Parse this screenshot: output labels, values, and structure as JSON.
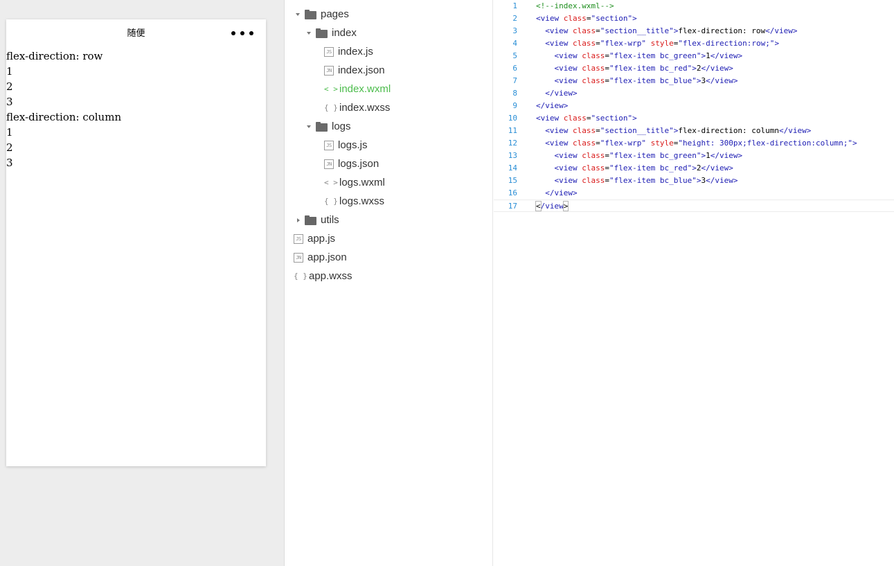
{
  "simulator": {
    "nav_title": "随便",
    "menu_icon": "more-dots-icon",
    "lines": [
      "flex-direction: row",
      "1",
      "2",
      "3",
      "flex-direction: column",
      "1",
      "2",
      "3"
    ]
  },
  "file_tree": {
    "items": [
      {
        "label": "pages",
        "type": "folder",
        "expanded": true,
        "depth": 0,
        "icon": "folder-open-icon"
      },
      {
        "label": "index",
        "type": "folder",
        "expanded": true,
        "depth": 1,
        "icon": "folder-open-icon"
      },
      {
        "label": "index.js",
        "type": "file",
        "badge": "JS",
        "depth": 2,
        "icon": "js-file-icon"
      },
      {
        "label": "index.json",
        "type": "file",
        "badge": "JN",
        "depth": 2,
        "icon": "json-file-icon"
      },
      {
        "label": "index.wxml",
        "type": "file",
        "glyph": "<>",
        "depth": 2,
        "active": true,
        "icon": "wxml-file-icon"
      },
      {
        "label": "index.wxss",
        "type": "file",
        "glyph": "{}",
        "depth": 2,
        "icon": "wxss-file-icon"
      },
      {
        "label": "logs",
        "type": "folder",
        "expanded": true,
        "depth": 1,
        "icon": "folder-open-icon"
      },
      {
        "label": "logs.js",
        "type": "file",
        "badge": "JS",
        "depth": 2,
        "icon": "js-file-icon"
      },
      {
        "label": "logs.json",
        "type": "file",
        "badge": "JN",
        "depth": 2,
        "icon": "json-file-icon"
      },
      {
        "label": "logs.wxml",
        "type": "file",
        "glyph": "<>",
        "depth": 2,
        "icon": "wxml-file-icon"
      },
      {
        "label": "logs.wxss",
        "type": "file",
        "glyph": "{}",
        "depth": 2,
        "icon": "wxss-file-icon"
      },
      {
        "label": "utils",
        "type": "folder",
        "expanded": false,
        "depth": 0,
        "icon": "folder-icon"
      },
      {
        "label": "app.js",
        "type": "file",
        "badge": "JS",
        "depth": 0,
        "icon": "js-file-icon"
      },
      {
        "label": "app.json",
        "type": "file",
        "badge": "JN",
        "depth": 0,
        "icon": "json-file-icon"
      },
      {
        "label": "app.wxss",
        "type": "file",
        "glyph": "{}",
        "depth": 0,
        "icon": "wxss-file-icon"
      }
    ],
    "active_color": "#4cbc4c"
  },
  "editor": {
    "file": "index.wxml",
    "current_line": 17,
    "lines": [
      {
        "n": "1",
        "tokens": [
          [
            "com",
            "<!--index.wxml-->"
          ]
        ]
      },
      {
        "n": "2",
        "tokens": [
          [
            "tag",
            "<view "
          ],
          [
            "attr",
            "class"
          ],
          [
            "txt",
            "="
          ],
          [
            "str",
            "\"section\""
          ],
          [
            "tag",
            ">"
          ]
        ]
      },
      {
        "n": "3",
        "tokens": [
          [
            "txt",
            "  "
          ],
          [
            "tag",
            "<view "
          ],
          [
            "attr",
            "class"
          ],
          [
            "txt",
            "="
          ],
          [
            "str",
            "\"section__title\""
          ],
          [
            "tag",
            ">"
          ],
          [
            "txt",
            "flex-direction: row"
          ],
          [
            "tag",
            "</view>"
          ]
        ]
      },
      {
        "n": "4",
        "tokens": [
          [
            "txt",
            "  "
          ],
          [
            "tag",
            "<view "
          ],
          [
            "attr",
            "class"
          ],
          [
            "txt",
            "="
          ],
          [
            "str",
            "\"flex-wrp\" "
          ],
          [
            "attr",
            "style"
          ],
          [
            "txt",
            "="
          ],
          [
            "str",
            "\"flex-direction:row;\""
          ],
          [
            "tag",
            ">"
          ]
        ]
      },
      {
        "n": "5",
        "tokens": [
          [
            "txt",
            "    "
          ],
          [
            "tag",
            "<view "
          ],
          [
            "attr",
            "class"
          ],
          [
            "txt",
            "="
          ],
          [
            "str",
            "\"flex-item bc_green\""
          ],
          [
            "tag",
            ">"
          ],
          [
            "txt",
            "1"
          ],
          [
            "tag",
            "</view>"
          ]
        ]
      },
      {
        "n": "6",
        "tokens": [
          [
            "txt",
            "    "
          ],
          [
            "tag",
            "<view "
          ],
          [
            "attr",
            "class"
          ],
          [
            "txt",
            "="
          ],
          [
            "str",
            "\"flex-item bc_red\""
          ],
          [
            "tag",
            ">"
          ],
          [
            "txt",
            "2"
          ],
          [
            "tag",
            "</view>"
          ]
        ]
      },
      {
        "n": "7",
        "tokens": [
          [
            "txt",
            "    "
          ],
          [
            "tag",
            "<view "
          ],
          [
            "attr",
            "class"
          ],
          [
            "txt",
            "="
          ],
          [
            "str",
            "\"flex-item bc_blue\""
          ],
          [
            "tag",
            ">"
          ],
          [
            "txt",
            "3"
          ],
          [
            "tag",
            "</view>"
          ]
        ]
      },
      {
        "n": "8",
        "tokens": [
          [
            "txt",
            "  "
          ],
          [
            "tag",
            "</view>"
          ]
        ]
      },
      {
        "n": "9",
        "tokens": [
          [
            "tag",
            "</view>"
          ]
        ]
      },
      {
        "n": "10",
        "tokens": [
          [
            "tag",
            "<view "
          ],
          [
            "attr",
            "class"
          ],
          [
            "txt",
            "="
          ],
          [
            "str",
            "\"section\""
          ],
          [
            "tag",
            ">"
          ]
        ]
      },
      {
        "n": "11",
        "tokens": [
          [
            "txt",
            "  "
          ],
          [
            "tag",
            "<view "
          ],
          [
            "attr",
            "class"
          ],
          [
            "txt",
            "="
          ],
          [
            "str",
            "\"section__title\""
          ],
          [
            "tag",
            ">"
          ],
          [
            "txt",
            "flex-direction: column"
          ],
          [
            "tag",
            "</view>"
          ]
        ]
      },
      {
        "n": "12",
        "tokens": [
          [
            "txt",
            "  "
          ],
          [
            "tag",
            "<view "
          ],
          [
            "attr",
            "class"
          ],
          [
            "txt",
            "="
          ],
          [
            "str",
            "\"flex-wrp\" "
          ],
          [
            "attr",
            "style"
          ],
          [
            "txt",
            "="
          ],
          [
            "str",
            "\"height: 300px;flex-direction:column;\""
          ],
          [
            "tag",
            ">"
          ]
        ]
      },
      {
        "n": "13",
        "tokens": [
          [
            "txt",
            "    "
          ],
          [
            "tag",
            "<view "
          ],
          [
            "attr",
            "class"
          ],
          [
            "txt",
            "="
          ],
          [
            "str",
            "\"flex-item bc_green\""
          ],
          [
            "tag",
            ">"
          ],
          [
            "txt",
            "1"
          ],
          [
            "tag",
            "</view>"
          ]
        ]
      },
      {
        "n": "14",
        "tokens": [
          [
            "txt",
            "    "
          ],
          [
            "tag",
            "<view "
          ],
          [
            "attr",
            "class"
          ],
          [
            "txt",
            "="
          ],
          [
            "str",
            "\"flex-item bc_red\""
          ],
          [
            "tag",
            ">"
          ],
          [
            "txt",
            "2"
          ],
          [
            "tag",
            "</view>"
          ]
        ]
      },
      {
        "n": "15",
        "tokens": [
          [
            "txt",
            "    "
          ],
          [
            "tag",
            "<view "
          ],
          [
            "attr",
            "class"
          ],
          [
            "txt",
            "="
          ],
          [
            "str",
            "\"flex-item bc_blue\""
          ],
          [
            "tag",
            ">"
          ],
          [
            "txt",
            "3"
          ],
          [
            "tag",
            "</view>"
          ]
        ]
      },
      {
        "n": "16",
        "tokens": [
          [
            "txt",
            "  "
          ],
          [
            "tag",
            "</view>"
          ]
        ]
      },
      {
        "n": "17",
        "tokens": [
          [
            "br",
            "<"
          ],
          [
            "tag",
            "/view"
          ],
          [
            "br",
            ">"
          ]
        ]
      }
    ]
  }
}
